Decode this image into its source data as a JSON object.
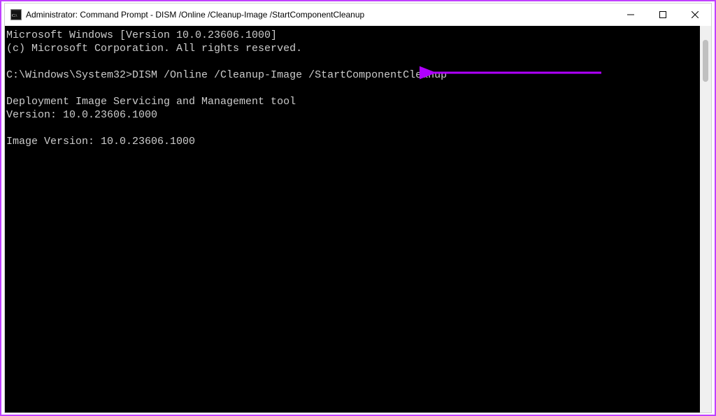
{
  "window": {
    "title": "Administrator: Command Prompt - DISM  /Online /Cleanup-Image /StartComponentCleanup",
    "app_icon_glyph": "C:\\"
  },
  "terminal": {
    "lines": [
      "Microsoft Windows [Version 10.0.23606.1000]",
      "(c) Microsoft Corporation. All rights reserved.",
      "",
      "C:\\Windows\\System32>DISM /Online /Cleanup-Image /StartComponentCleanup",
      "",
      "Deployment Image Servicing and Management tool",
      "Version: 10.0.23606.1000",
      "",
      "Image Version: 10.0.23606.1000",
      ""
    ]
  },
  "annotation": {
    "arrow_color": "#b000ff"
  }
}
